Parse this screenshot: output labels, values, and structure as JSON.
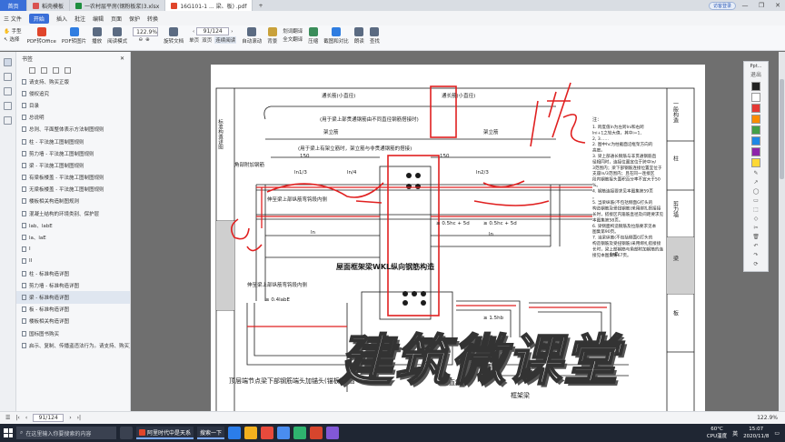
{
  "tabs": [
    {
      "label": "首页",
      "type": "home"
    },
    {
      "label": "稻壳模板",
      "color": "#d9534f"
    },
    {
      "label": "一农村层平房(钢粉板浆)3.xlsx",
      "color": "#1e8e3e"
    },
    {
      "label": "16G101-1 ... 梁、板) .pdf",
      "color": "#e0452b",
      "active": true
    }
  ],
  "tab_new": "+",
  "login_label": "访客登录",
  "window_controls": [
    "—",
    "❐",
    "✕"
  ],
  "menu": {
    "file": "三 文件",
    "items": [
      "开始",
      "插入",
      "批注",
      "编辑",
      "页面",
      "保护",
      "转换"
    ],
    "active": "开始"
  },
  "toolbar": {
    "hand": "手型",
    "select": "选择",
    "pdf_office": "PDF转Office",
    "pdf_image": "PDF转图片",
    "play": "播放",
    "read_mode": "阅读模式",
    "zoom": "122.9%",
    "rotate": "旋转文档",
    "page_current": "91",
    "page_total": "124",
    "single": "单页",
    "double": "双页",
    "continuous": "连续阅读",
    "auto_scroll": "自动滚动",
    "background": "背景",
    "translate_select": "划词翻译",
    "translate_full": "全文翻译",
    "compress": "压缩",
    "screenshot": "截图和对比",
    "read_aloud": "朗读",
    "find": "查找"
  },
  "sidebar": {
    "title": "书签",
    "items": [
      {
        "label": "请支持、购买正版"
      },
      {
        "label": "侵权追究"
      },
      {
        "label": "目录"
      },
      {
        "label": "总说明"
      },
      {
        "label": "总则、平面整体表示方法制图规则"
      },
      {
        "label": "柱 - 平法施工图制图规则"
      },
      {
        "label": "剪力墙 - 平法施工图制图规则"
      },
      {
        "label": "梁 - 平法施工图制图规则"
      },
      {
        "label": "有梁板楼盖 - 平法施工图制图规则"
      },
      {
        "label": "无梁板楼盖 - 平法施工图制图规则"
      },
      {
        "label": "楼板相关构造制图规则"
      },
      {
        "label": "混凝土结构的环境类别、保护层"
      },
      {
        "label": "lab、labE"
      },
      {
        "label": "la、laE"
      },
      {
        "label": "I"
      },
      {
        "label": "II"
      },
      {
        "label": "柱 - 标准构造详图"
      },
      {
        "label": "剪力墙 - 标准构造详图"
      },
      {
        "label": "梁 - 标准构造详图",
        "selected": true
      },
      {
        "label": "板 - 标准构造详图"
      },
      {
        "label": "楼板相关构造详图"
      },
      {
        "label": "国标图书购买"
      },
      {
        "label": "启示、复制、传播盗违法行为。请支持、购买正版。"
      }
    ]
  },
  "drawing": {
    "title_left": "标准构造详图",
    "title_right_top": "一般构造",
    "title_right_2": "柱",
    "title_right_3": "剪力墙",
    "title_right_4": "梁",
    "title_right_5": "板",
    "long_bar_top": "通长筋(小直径)",
    "long_bar_top2": "通长筋(小直径)",
    "note1": "(用于梁上部贯通钢筋由不同直径钢筋搭接时)",
    "stirrup_bar": "架立筋",
    "stirrup_bar2": "架立筋",
    "note2": "(用于梁上有架立筋时，架立筋与非贯通钢筋的搭接)",
    "corner_bar": "角部附加钢筋",
    "dim_150": "150",
    "ln1": "ln1/3",
    "ln2": "ln2/3",
    "ln4": "ln/4",
    "ln": "ln",
    "label_bottom_bar": "伸至梁上部纵筋弯钩段内侧",
    "label_bottom_bar2": "伸至梁上部纵筋弯钩段内侧",
    "dim_a": "≥ 0.5hc + 5d",
    "dim_b": "≥ 0.5hc + 5d",
    "dim_c": "laE",
    "main_title": "屋面框架梁WKL纵向钢筋构造",
    "note_left": "顶层端节点梁下部钢筋端头加锚头(锚板)锚固",
    "note_mid": "直锚",
    "note_mid2": "框架梁",
    "dim_15": "≥ 1.5hb",
    "dim_04": "≥ 0.4lab",
    "dim_04b": "≥ 0.4labE",
    "notes_title": "注：",
    "notes": [
      "1. 跨度值ln为左跨lni和右跨lni+1之较大值，其中i=1, 2, 3……",
      "2. 图中hc为柱截面沿框架方向的高度。",
      "3. 梁上部通长钢筋与非贯通钢筋直径相同时，连接位置宜位于跨中ln/3范围内；梁下部钢筋连接位置宜位于支座ln/3范围内；且在同一连接区段内钢筋接头面积百分率不宜大于50%。",
      "4. 钢筋连接要求见本图集第59页。",
      "5. 当梁纵筋(不包括侧面G打头的构造钢筋及受扭钢筋)采用绑扎搭接接长时，搭接区内箍筋直径及间距要求见本图集第58页。",
      "6. 梁侧面构造钢筋及拉筋要求见本图集第90页。",
      "7. 当梁纵筋(不包括侧面G打头的构造钢筋及受扭钢筋)采用绑扎搭接接长时，梁上部钢筋与角部附加钢筋的连接见本图集第67页。"
    ],
    "marks": [
      "h",
      "hc",
      "ln",
      "ln/3"
    ]
  },
  "annotations": {
    "handwritten": "l/3"
  },
  "watermark": "建筑微课堂",
  "pen_panel": {
    "title": "Ppt...",
    "swatches": [
      "#222222",
      "#ffffff",
      "#e53935",
      "#fb8c00",
      "#43a047",
      "#1e88e5",
      "#8e24aa",
      "#fdd835"
    ],
    "tools": [
      "退出",
      "✎",
      "↗",
      "◯",
      "▭",
      "⬚",
      "◇",
      "✂",
      "🗑",
      "↶",
      "↷",
      "⟳"
    ]
  },
  "status": {
    "page": "91/124",
    "zoom": "122.9%"
  },
  "taskbar": {
    "search": "在这里输入你要搜索的内容",
    "app_label": "阿里时代中是天系",
    "app2": "搜索一下",
    "weather": "60°C",
    "cpu": "CPU温度",
    "lang": "英",
    "time": "15:07",
    "date": "2020/11/8"
  },
  "colors": {
    "accent": "#3a6fd8",
    "annotation_red": "#e02020",
    "drawing_ink": "#1b1b1b"
  }
}
